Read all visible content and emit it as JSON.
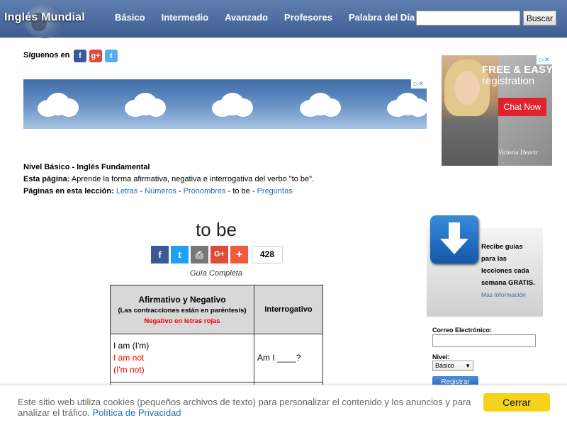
{
  "header": {
    "logo": "Inglés Mundial",
    "nav": [
      "Básico",
      "Intermedio",
      "Avanzado",
      "Profesores",
      "Palabra del Día"
    ],
    "search_button": "Buscar",
    "search_value": ""
  },
  "follow": {
    "label": "Síguenos en",
    "icons": [
      "facebook-icon",
      "google-plus-icon",
      "twitter-icon"
    ]
  },
  "ad_side": {
    "line1": "FREE & EASY",
    "line2": "registration",
    "button": "Chat Now",
    "brand": "Victoria Hearts"
  },
  "info": {
    "level_prefix": "Nivel Básico - Inglés Fundamental",
    "page_label": "Esta página:",
    "page_desc": "Aprende la forma afirmativa, negativa e interrogativa del verbo \"to be\".",
    "lessons_label": "Páginas en esta lección:",
    "lessons": [
      {
        "text": "Letras",
        "link": true
      },
      {
        "text": "Números",
        "link": true
      },
      {
        "text": "Pronombres",
        "link": true
      },
      {
        "text": "to be",
        "link": false
      },
      {
        "text": "Preguntas",
        "link": true
      }
    ],
    "separator": " - "
  },
  "main": {
    "title": "to be",
    "share_count": "428",
    "guide": "Guía Completa",
    "table": {
      "col1_title": "Afirmativo y Negativo",
      "col1_note": "(Las contracciones están en paréntesis)",
      "col1_red": "Negativo en letras rojas",
      "col2_title": "Interrogativo",
      "row1_aff": "I am (I'm)",
      "row1_neg1": "I am not",
      "row1_neg2": "(I'm not)",
      "row1_q": "Am I ____?"
    }
  },
  "signup": {
    "text": "Recibe guías para las lecciones cada semana GRATIS.",
    "more": "Más Información",
    "email_label": "Correo Electrónico:",
    "level_label": "Nivel:",
    "level_value": "Básico",
    "button": "Registrar"
  },
  "cookie": {
    "text": "Este sitio web utiliza cookies (pequeños archivos de texto) para personalizar el contenido y los anuncios y para analizar el tráfico.",
    "link": "Política de Privacidad",
    "button": "Cerrar"
  },
  "colors": {
    "nav_bg": "#4a6aa0",
    "link": "#2a6bb1",
    "negative": "#e00000",
    "cookie_button": "#f5d31b"
  }
}
